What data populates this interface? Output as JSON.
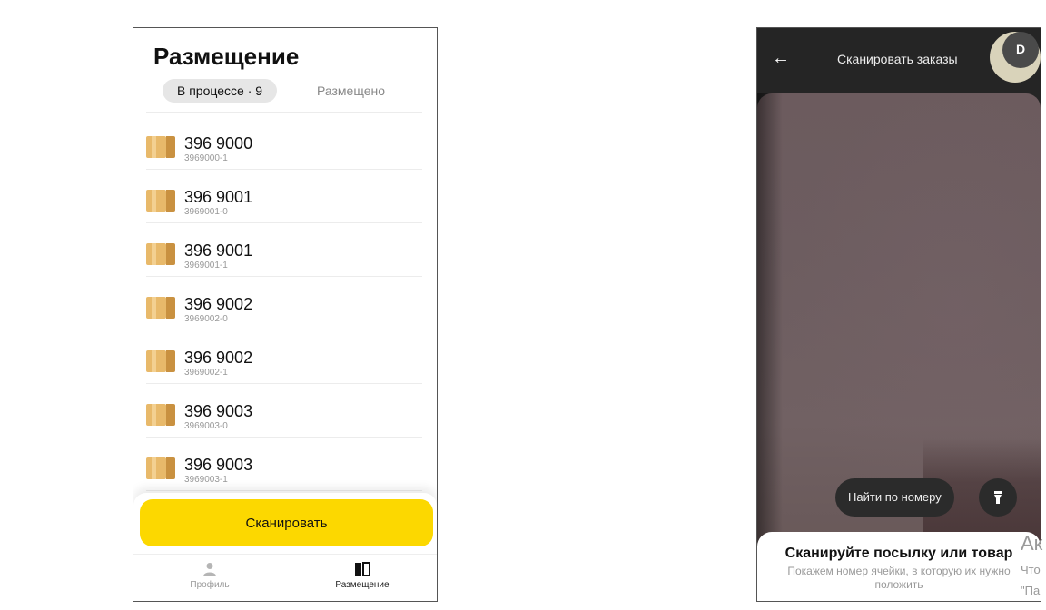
{
  "left_screen": {
    "title": "Размещение",
    "tabs": [
      {
        "label": "В процессе · 9",
        "active": true
      },
      {
        "label": "Размещено",
        "active": false
      }
    ],
    "items": [
      {
        "name": "396 9000",
        "code": "3969000-1"
      },
      {
        "name": "396 9001",
        "code": "3969001-0"
      },
      {
        "name": "396 9001",
        "code": "3969001-1"
      },
      {
        "name": "396 9002",
        "code": "3969002-0"
      },
      {
        "name": "396 9002",
        "code": "3969002-1"
      },
      {
        "name": "396 9003",
        "code": "3969003-0"
      },
      {
        "name": "396 9003",
        "code": "3969003-1"
      }
    ],
    "scan_button": "Сканировать",
    "nav": [
      {
        "label": "Профиль",
        "icon": "person-icon",
        "active": false
      },
      {
        "label": "Размещение",
        "icon": "book-icon",
        "active": true
      }
    ],
    "colors": {
      "accent": "#fcd800",
      "box": "#e8b96a"
    }
  },
  "right_screen": {
    "header_title": "Сканировать заказы",
    "avatar_letter": "D",
    "find_button": "Найти по номеру",
    "sheet_title": "Сканируйте посылку или товар",
    "sheet_subtitle": "Покажем номер ячейки, в которую их нужно положить",
    "icons": {
      "back": "arrow-left-icon",
      "flash": "flashlight-icon"
    }
  },
  "side_text": [
    "Ак",
    "Что",
    "\"Па"
  ]
}
